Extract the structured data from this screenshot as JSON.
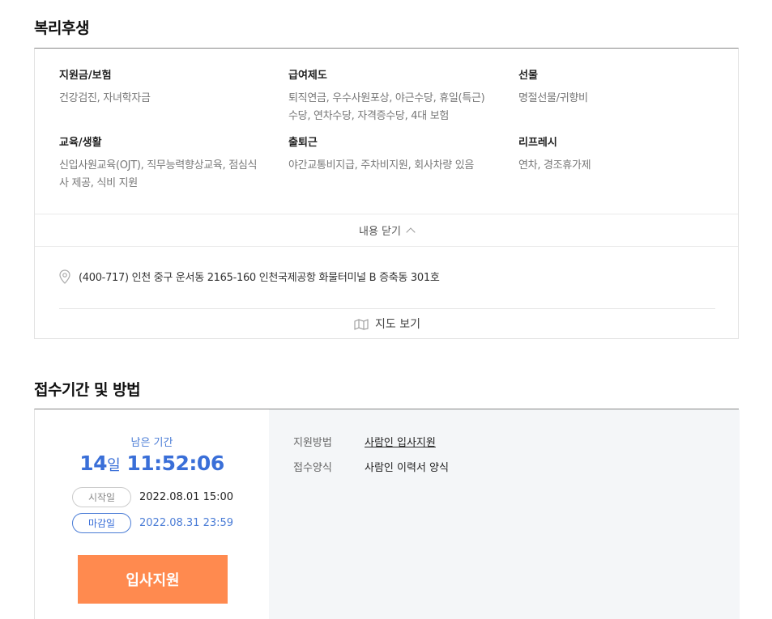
{
  "welfare": {
    "title": "복리후생",
    "categories": [
      {
        "title": "지원금/보험",
        "desc": "건강검진, 자녀학자금"
      },
      {
        "title": "급여제도",
        "desc": "퇴직연금, 우수사원포상, 야근수당, 휴일(특근)수당, 연차수당, 자격증수당, 4대 보험"
      },
      {
        "title": "선물",
        "desc": "명절선물/귀향비"
      },
      {
        "title": "교육/생활",
        "desc": "신입사원교육(OJT), 직무능력향상교육, 점심식사 제공, 식비 지원"
      },
      {
        "title": "출퇴근",
        "desc": "야간교통비지급, 주차비지원, 회사차량 있음"
      },
      {
        "title": "리프레시",
        "desc": "연차, 경조휴가제"
      }
    ],
    "toggle_label": "내용 닫기",
    "address": "(400-717) 인천 중구 운서동 2165-160 인천국제공항 화물터미널 B 증축동 301호",
    "map_label": "지도 보기"
  },
  "application": {
    "title": "접수기간 및 방법",
    "remaining_label": "남은 기간",
    "remaining_days": "14",
    "remaining_days_unit": "일",
    "remaining_time": "11:52:06",
    "start_label": "시작일",
    "start_date": "2022.08.01 15:00",
    "deadline_label": "마감일",
    "deadline_date": "2022.08.31 23:59",
    "apply_button": "입사지원",
    "method_label": "지원방법",
    "method_value": "사람인 입사지원",
    "form_label": "접수양식",
    "form_value": "사람인 이력서 양식",
    "accent_color": "#3a6fd8",
    "button_color": "#ff8a4f"
  }
}
